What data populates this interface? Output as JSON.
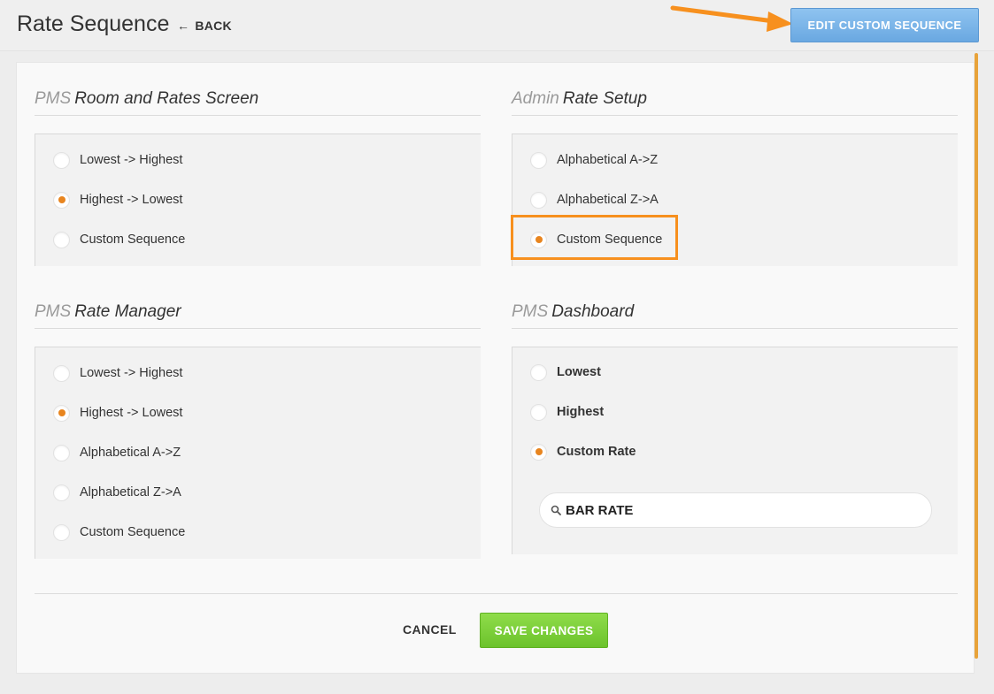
{
  "header": {
    "title": "Rate Sequence",
    "back_label": "BACK",
    "edit_button_label": "EDIT CUSTOM SEQUENCE"
  },
  "sections": {
    "room_rates": {
      "prefix": "PMS",
      "title": "Room and Rates Screen",
      "options": [
        {
          "label": "Lowest -> Highest",
          "checked": false
        },
        {
          "label": "Highest -> Lowest",
          "checked": true
        },
        {
          "label": "Custom Sequence",
          "checked": false
        }
      ]
    },
    "admin_rate_setup": {
      "prefix": "Admin",
      "title": "Rate Setup",
      "options": [
        {
          "label": "Alphabetical A->Z",
          "checked": false
        },
        {
          "label": "Alphabetical Z->A",
          "checked": false
        },
        {
          "label": "Custom Sequence",
          "checked": true
        }
      ]
    },
    "rate_manager": {
      "prefix": "PMS",
      "title": "Rate Manager",
      "options": [
        {
          "label": "Lowest -> Highest",
          "checked": false
        },
        {
          "label": "Highest -> Lowest",
          "checked": true
        },
        {
          "label": "Alphabetical A->Z",
          "checked": false
        },
        {
          "label": "Alphabetical Z->A",
          "checked": false
        },
        {
          "label": "Custom Sequence",
          "checked": false
        }
      ]
    },
    "dashboard": {
      "prefix": "PMS",
      "title": "Dashboard",
      "options": [
        {
          "label": "Lowest",
          "checked": false
        },
        {
          "label": "Highest",
          "checked": false
        },
        {
          "label": "Custom Rate",
          "checked": true
        }
      ],
      "custom_rate_value": "BAR RATE"
    }
  },
  "footer": {
    "cancel_label": "CANCEL",
    "save_label": "SAVE CHANGES"
  },
  "colors": {
    "accent_orange": "#f7901e",
    "radio_dot": "#e8851f",
    "edit_button": "#7ab4e8",
    "save_button": "#7ed03a"
  }
}
